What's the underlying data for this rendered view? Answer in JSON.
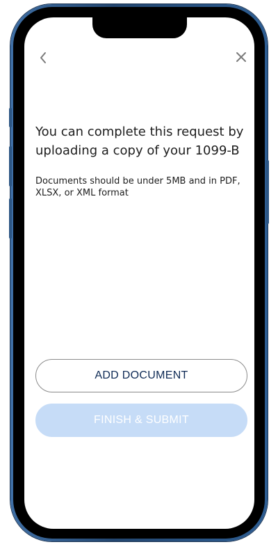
{
  "nav": {
    "back_icon": "chevron-left-icon",
    "close_icon": "close-icon"
  },
  "content": {
    "heading": "You can complete this request by uploading a copy of your 1099-B",
    "note": "Documents should be under 5MB and in PDF, XLSX, or XML format"
  },
  "actions": {
    "add_document_label": "ADD DOCUMENT",
    "finish_submit_label": "FINISH & SUBMIT",
    "finish_submit_enabled": false
  },
  "colors": {
    "frame": "#2d5d92",
    "text": "#1d1d1d",
    "add_button_text": "#0e2a55",
    "submit_disabled_bg": "#c6dcf7",
    "icon_gray": "#7a7a7a"
  }
}
